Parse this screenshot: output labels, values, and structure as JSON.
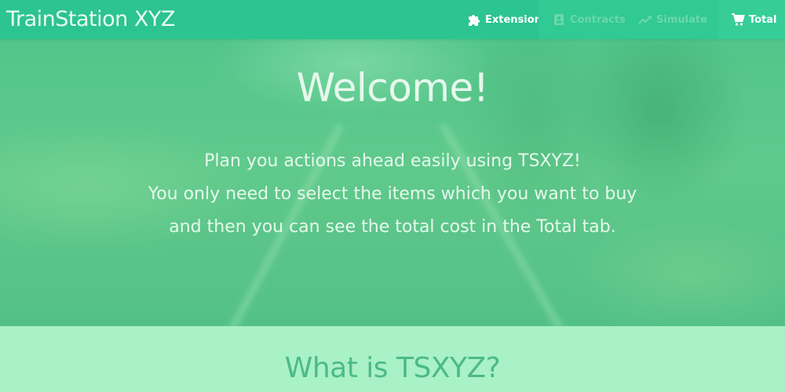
{
  "navbar": {
    "brand": "TrainStation XYZ",
    "items": [
      {
        "label": "Extensions",
        "icon": "puzzle-icon"
      },
      {
        "label": "Contracts",
        "icon": "contract-icon"
      },
      {
        "label": "Simulate",
        "icon": "trend-icon"
      },
      {
        "label": "Total",
        "icon": "cart-icon"
      }
    ]
  },
  "hero": {
    "title": "Welcome!",
    "lines": [
      "Plan you actions ahead easily using TSXYZ!",
      "You only need to select the items which you want to buy",
      "and then you can see the total cost in the Total tab."
    ]
  },
  "section": {
    "title": "What is TSXYZ?"
  },
  "colors": {
    "navbar": "#2cc490",
    "section_bg": "#a9f1c6",
    "section_title": "#4cba87"
  }
}
